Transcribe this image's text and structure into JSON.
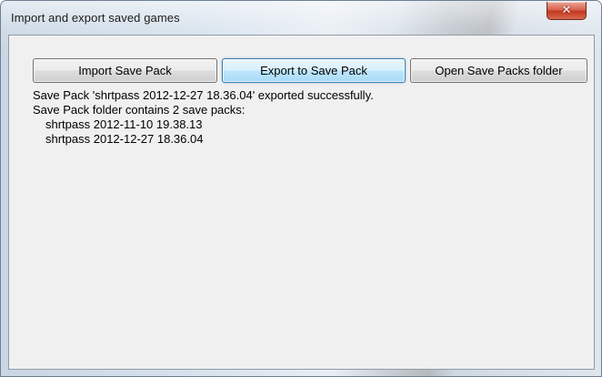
{
  "window": {
    "title": "Import and export saved games",
    "close_glyph": "✕"
  },
  "buttons": {
    "import_label": "Import Save Pack",
    "export_label": "Export to Save Pack",
    "open_folder_label": "Open Save Packs folder"
  },
  "output": {
    "status_line": "Save Pack 'shrtpass 2012-12-27 18.36.04' exported successfully.",
    "folder_line": "Save Pack folder contains 2 save packs:",
    "save_packs": [
      "shrtpass 2012-11-10 19.38.13",
      "shrtpass 2012-12-27 18.36.04"
    ]
  },
  "colors": {
    "close_button": "#c4381f",
    "default_button_border": "#3c7fb1",
    "client_background": "#f0f0f0"
  }
}
